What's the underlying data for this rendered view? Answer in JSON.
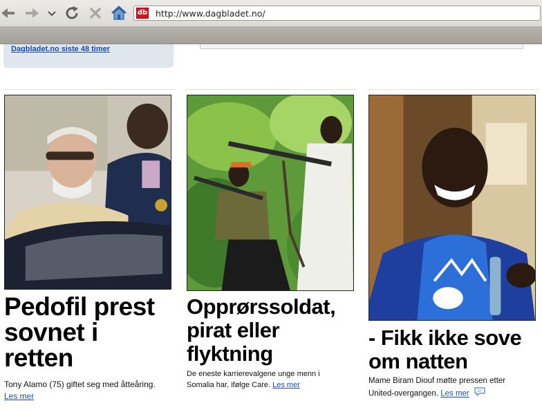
{
  "browser": {
    "url": "http://www.dagbladet.no/",
    "favicon_text": "db",
    "buttons": [
      {
        "name": "back-icon"
      },
      {
        "name": "forward-icon"
      },
      {
        "name": "history-dropdown-icon"
      },
      {
        "name": "reload-icon"
      },
      {
        "name": "stop-icon"
      },
      {
        "name": "home-icon"
      }
    ]
  },
  "sidebar_box": {
    "link": "Dagbladet.no siste 48 timer"
  },
  "stories": [
    {
      "headline_lines": [
        "Pedofil prest",
        "sovnet i",
        "retten"
      ],
      "lead": "Tony Alamo (75) giftet seg med åtteåring.",
      "more_link": "Les mer",
      "image": "photo of elderly man with sunglasses beside officer"
    },
    {
      "headline_lines": [
        "Opprørssoldat,",
        "pirat eller",
        "flyktning"
      ],
      "lead_lines": [
        "De eneste karrierevalgene unge menn i",
        "Somalia har, ifølge Care."
      ],
      "more_link": "Les mer",
      "image": "photo of armed soldiers in greenery"
    },
    {
      "headline_lines": [
        "- Fikk ikke sove",
        "om natten"
      ],
      "lead_lines": [
        "Mame Biram Diouf møtte pressen etter",
        "United-overgangen."
      ],
      "more_link": "Les mer",
      "comment_icon": "speech-bubble-icon",
      "image": "photo of smiling football player in blue jacket"
    }
  ],
  "colors": {
    "link": "#1a4ca8",
    "brand_red": "#d8131b",
    "info_box_bg": "#dfe6ee"
  }
}
